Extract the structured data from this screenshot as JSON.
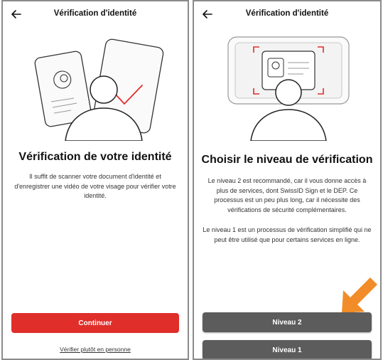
{
  "left_screen": {
    "header_title": "Vérification d'identité",
    "heading": "Vérification de votre identité",
    "description": "Il suffit de scanner votre document d'identité et d'enregistrer une vidéo de votre visage pour vérifier votre identité.",
    "primary_button": "Continuer",
    "secondary_link": "Vérifier plutôt en personne"
  },
  "right_screen": {
    "header_title": "Vérification d'identité",
    "heading": "Choisir le niveau de vérification",
    "paragraph_1": "Le niveau 2 est recommandé, car il vous donne accès à plus de services, dont SwissID Sign et le DEP. Ce processus est un peu plus long, car il nécessite des vérifications de sécurité complémentaires.",
    "paragraph_2": "Le niveau 1 est un processus de vérification simplifié qui ne peut être utilisé que pour certains services en ligne.",
    "button_level_2": "Niveau 2",
    "button_level_1": "Niveau 1"
  },
  "icons": [
    "back-arrow-icon",
    "id-card-illustration",
    "phone-checkmark-illustration",
    "person-avatar-illustration",
    "scan-frame-illustration",
    "orange-pointer-arrow-icon"
  ],
  "colors": {
    "primary_red": "#e02e2a",
    "button_gray": "#5c5c5c",
    "checkmark_red": "#e02e2a",
    "arrow_orange": "#f28c28",
    "frame_red": "#e02e2a"
  }
}
